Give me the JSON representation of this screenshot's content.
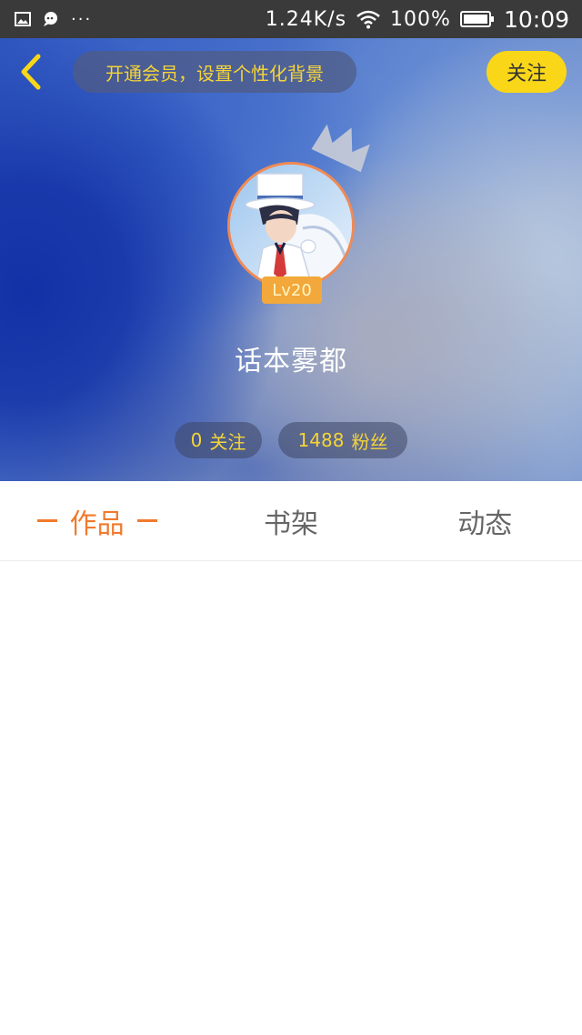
{
  "status_bar": {
    "network_speed": "1.24K/s",
    "battery": "100%",
    "time": "10:09",
    "overflow": "···",
    "icons": [
      "image-icon",
      "chat-bubble-icon",
      "wifi-icon",
      "battery-icon"
    ]
  },
  "header": {
    "back_icon": "chevron-left-icon",
    "vip_banner": "开通会员，设置个性化背景",
    "follow_button": "关注",
    "crown_icon": "crown-icon",
    "level": "Lv20",
    "username": "话本雾都",
    "stats": {
      "following_count": "0",
      "following_label": "关注",
      "fans_count": "1488",
      "fans_label": "粉丝"
    }
  },
  "tabs": [
    {
      "label": "作品",
      "active": true
    },
    {
      "label": "书架",
      "active": false
    },
    {
      "label": "动态",
      "active": false
    }
  ],
  "colors": {
    "accent_yellow": "#f9d718",
    "accent_orange": "#f07a2e",
    "level_badge": "#f2a83a",
    "status_bar": "#3a3a3a"
  }
}
